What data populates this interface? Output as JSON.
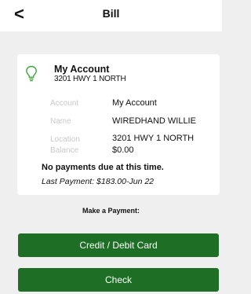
{
  "header": {
    "back_icon": "chevron-left-icon",
    "back_glyph": "<",
    "title": "Bill"
  },
  "account_card": {
    "icon": "lightbulb-icon",
    "icon_color": "#3aa537",
    "account_name": "My Account",
    "address": "3201 HWY 1 NORTH",
    "details": [
      {
        "label": "Account",
        "value": "My Account"
      },
      {
        "label": "Name",
        "value": "WIREDHAND WILLIE"
      },
      {
        "label": "Location",
        "value": "3201 HWY 1 NORTH"
      },
      {
        "label": "Balance",
        "value": "$0.00"
      }
    ],
    "no_payments_text": "No payments due at this time.",
    "last_payment_text": "Last Payment: $183.00-Jun 22"
  },
  "payment": {
    "heading": "Make a Payment:",
    "card_button_label": "Credit / Debit Card",
    "check_button_label": "Check",
    "button_color": "#1f6e25"
  }
}
